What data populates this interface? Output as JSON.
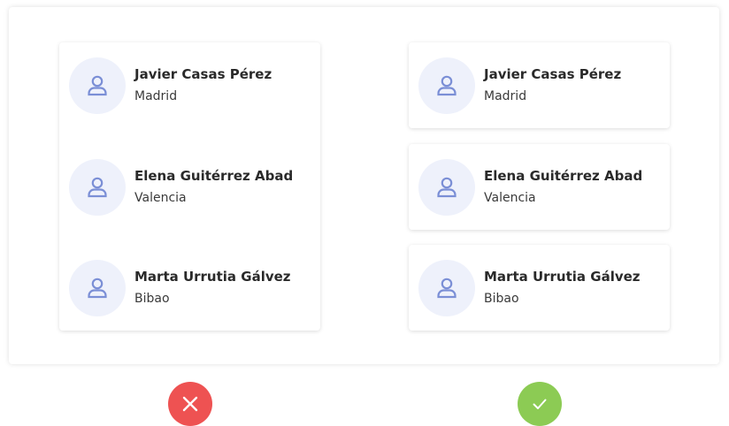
{
  "examples": {
    "incorrect": {
      "people": [
        {
          "name": "Javier Casas Pérez",
          "city": "Madrid"
        },
        {
          "name": "Elena Guitérrez Abad",
          "city": "Valencia"
        },
        {
          "name": "Marta Urrutia Gálvez",
          "city": "Bibao"
        }
      ],
      "verdict_icon": "close-icon",
      "verdict_color": "#ee5252"
    },
    "correct": {
      "people": [
        {
          "name": "Javier Casas Pérez",
          "city": "Madrid"
        },
        {
          "name": "Elena Guitérrez Abad",
          "city": "Valencia"
        },
        {
          "name": "Marta Urrutia Gálvez",
          "city": "Bibao"
        }
      ],
      "verdict_icon": "check-icon",
      "verdict_color": "#8ccb54"
    }
  },
  "colors": {
    "avatar_bg": "#eef1fb",
    "avatar_icon": "#7b8fd6"
  }
}
